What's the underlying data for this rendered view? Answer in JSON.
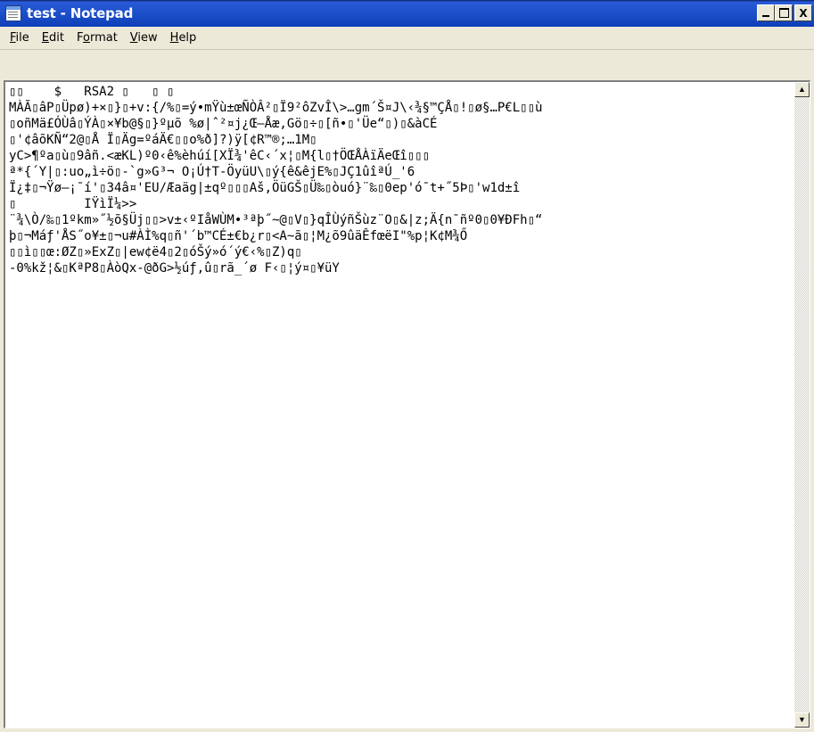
{
  "window": {
    "title": "test - Notepad",
    "icon": "notepad-icon"
  },
  "title_buttons": {
    "minimize": "_",
    "maximize": "□",
    "close": "X"
  },
  "menu": {
    "file": "File",
    "edit": "Edit",
    "format": "Format",
    "view": "View",
    "help": "Help"
  },
  "document": {
    "lines": [
      "▯▯    $   RSA2 ▯   ▯ ▯",
      "MÀÃ▯âP▯Üpø)+×▯}▯+v:{/%▯=ý•mŸù±œÑÒÂ²▯Ï9²ôZvÎ\\>…gm´Š¤J\\‹¾§™ÇÅ▯!▯ø§…P€L▯▯ù",
      "▯oñMä£ÓÙâ▯ÝÀ▯×¥b@§▯}ºµõ %ø|ˆ²¤j¿Œ–Åæ,Gö▯÷▯[ñ•▯'Üe“▯)▯&àCÉ",
      "▯'¢âõKÑ“2@▯Å Ï▯Äg=ºáÄ€▯▯o%ð]?)ÿ[¢R™®;…1M▯",
      "yC>¶ºa▯ù▯9âñ.<æKL)º0‹ê%èhúí[XÏ¾'êC‹´x¦▯M{l▯†ÖŒÅÀïÄeŒî▯▯▯",
      "ª*{´Y|▯:uo„ì÷ö▯-`g»G³¬ O¡Ú†T-ÖyüU\\▯ý{ê&êjE%▯JÇ1ûîªÚ_'6",
      "Ï¿‡▯¬Ÿø–¡¯í'▯34â¤'EU/Æaäg|±qº▯▯▯Aš,ÖüGŠ▯Ü‰▯òuó}¨‰▯0ep'ó¯t+˝5Þ▯'w1d±î",
      "▯         IŸìÏ¼>>",
      "¨¾\\Ò/‰▯1ºkm»˝½õ§Üj▯▯>v±‹ºIåWÙM•³ªþ˝~@▯V▯}qÎÙýñŠùz¨O▯&|z;Ä{n¯ñº0▯0¥ÐFh▯“",
      "þ▯¬Máƒ'ÅS˝o¥±▯¬u#ÀÌ%q▯ñ'´b™CÉ±€b¿r▯<A~ã▯¦M¿õ9ûäÊfœëI\"%p¦K¢M¾Ő",
      "▯▯ì▯▯œ:ØZ▯»ExZ▯|ew¢ë4▯2▯óŠý»ó´ý€‹%▯Z)q▯",
      "-0%kž¦&▯KªP8▯ÀòQx-@ðG>½úƒ,û▯rã_´ø F‹▯¦ý¤▯¥üY"
    ]
  },
  "scrollbar": {
    "up_arrow": "▲",
    "down_arrow": "▼"
  }
}
